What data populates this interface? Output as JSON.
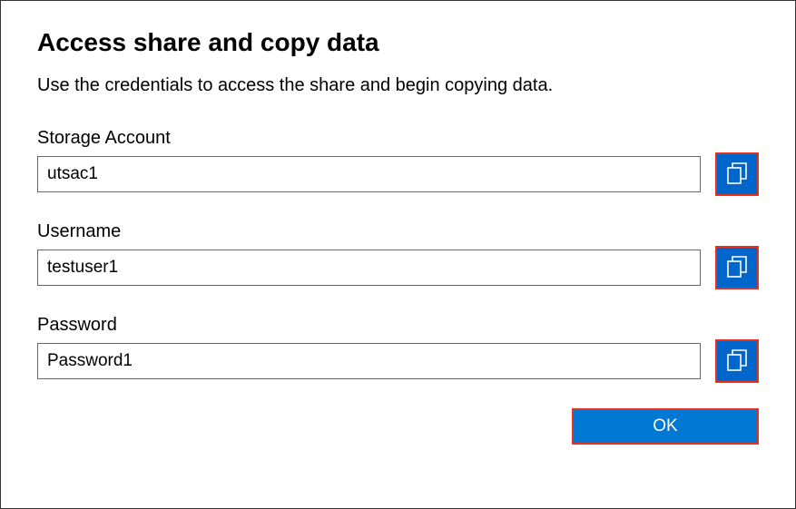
{
  "dialog": {
    "title": "Access share and copy data",
    "description": "Use the credentials to access the share and begin copying data."
  },
  "fields": {
    "storage_account": {
      "label": "Storage Account",
      "value": "utsac1"
    },
    "username": {
      "label": "Username",
      "value": "testuser1"
    },
    "password": {
      "label": "Password",
      "value": "Password1"
    }
  },
  "buttons": {
    "ok_label": "OK"
  }
}
